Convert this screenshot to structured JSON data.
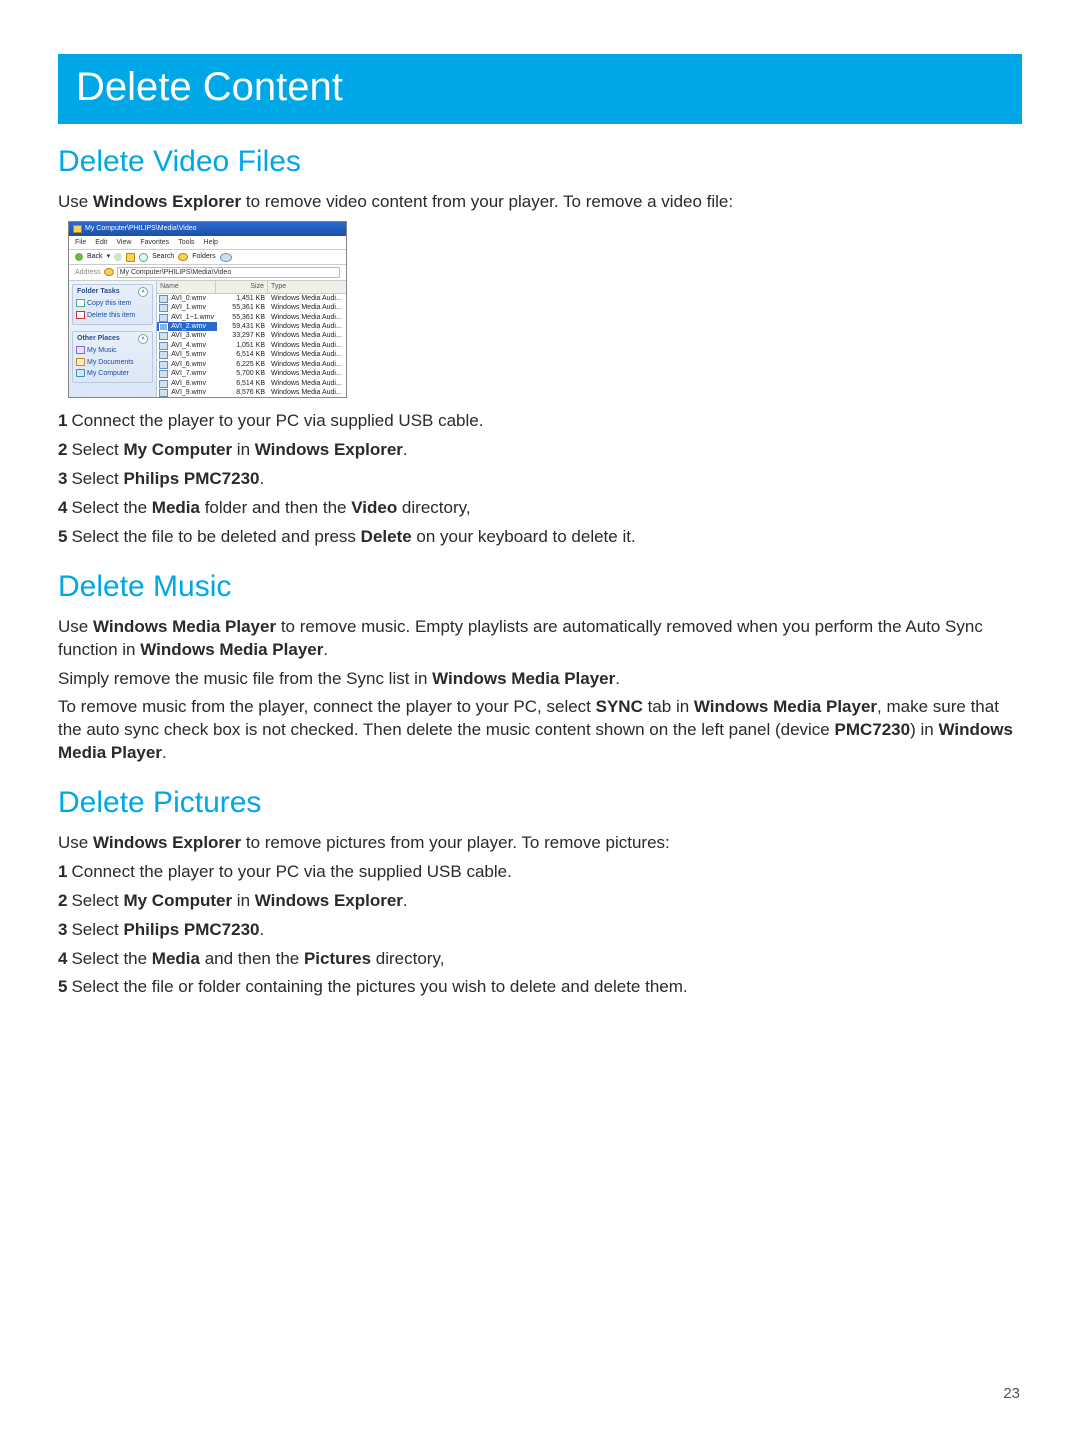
{
  "page_number": "23",
  "banner": "Delete Content",
  "sections": {
    "video": {
      "heading": "Delete Video Files",
      "intro_a": "Use ",
      "intro_b": "Windows Explorer",
      "intro_c": " to remove video content from your player. To remove a video file:",
      "steps": {
        "s1": "Connect the player to your PC via supplied USB cable.",
        "s2a": "Select ",
        "s2b": "My Computer",
        "s2c": " in ",
        "s2d": "Windows Explorer",
        "s2e": ".",
        "s3a": "Select ",
        "s3b": "Philips PMC7230",
        "s3c": ".",
        "s4a": "Select the ",
        "s4b": "Media",
        "s4c": " folder and then the ",
        "s4d": "Video",
        "s4e": " directory,",
        "s5a": "Select the file to be deleted and press ",
        "s5b": "Delete",
        "s5c": " on your keyboard to delete it."
      }
    },
    "music": {
      "heading": "Delete Music",
      "p1a": "Use ",
      "p1b": "Windows Media Player",
      "p1c": " to remove music. Empty playlists are automatically removed when you perform the Auto Sync function in ",
      "p1d": "Windows Media Player",
      "p1e": ".",
      "p2a": "Simply remove the music file from the Sync list in ",
      "p2b": "Windows Media Player",
      "p2c": ".",
      "p3a": "To remove music from the player, connect the player to your PC, select ",
      "p3b": "SYNC",
      "p3c": " tab in ",
      "p3d": "Windows Media Player",
      "p3e": ", make sure that the auto sync check box is not checked. Then delete the music content shown on the left panel (device ",
      "p3f": "PMC7230",
      "p3g": ") in ",
      "p3h": "Windows Media Player",
      "p3i": "."
    },
    "pictures": {
      "heading": "Delete Pictures",
      "intro_a": "Use ",
      "intro_b": "Windows Explorer",
      "intro_c": " to remove pictures from your player. To remove pictures:",
      "steps": {
        "s1": "Connect the player to your PC via the supplied USB cable.",
        "s2a": "Select ",
        "s2b": "My Computer",
        "s2c": " in ",
        "s2d": "Windows Explorer",
        "s2e": ".",
        "s3a": "Select ",
        "s3b": "Philips PMC7230",
        "s3c": ".",
        "s4a": "Select the ",
        "s4b": "Media",
        "s4c": " and then the ",
        "s4d": "Pictures",
        "s4e": " directory,",
        "s5": "Select the file or folder containing the pictures you wish to delete and delete them."
      }
    }
  },
  "explorer": {
    "title": "My Computer\\PHILIPS\\Media\\Video",
    "menu": [
      "File",
      "Edit",
      "View",
      "Favorites",
      "Tools",
      "Help"
    ],
    "back": "Back",
    "search": "Search",
    "folders": "Folders",
    "address_label": "Address",
    "address_path": "My Computer\\PHILIPS\\Media\\Video",
    "side": {
      "tasks_h": "Folder Tasks",
      "task_copy": "Copy this item",
      "task_delete": "Delete this item",
      "places_h": "Other Places",
      "place_music": "My Music",
      "place_docs": "My Documents",
      "place_comp": "My Computer"
    },
    "cols": {
      "name": "Name",
      "size": "Size",
      "type": "Type"
    },
    "type_label": "Windows Media Audi...",
    "rows": [
      {
        "name": "AVI_0.wmv",
        "size": "1,451 KB",
        "sel": false
      },
      {
        "name": "AVI_1.wmv",
        "size": "55,361 KB",
        "sel": false
      },
      {
        "name": "AVI_1~1.wmv",
        "size": "55,361 KB",
        "sel": false
      },
      {
        "name": "AVI_2.wmv",
        "size": "59,431 KB",
        "sel": true
      },
      {
        "name": "AVI_3.wmv",
        "size": "33,297 KB",
        "sel": false
      },
      {
        "name": "AVI_4.wmv",
        "size": "1,051 KB",
        "sel": false
      },
      {
        "name": "AVI_5.wmv",
        "size": "6,514 KB",
        "sel": false
      },
      {
        "name": "AVI_6.wmv",
        "size": "6,225 KB",
        "sel": false
      },
      {
        "name": "AVI_7.wmv",
        "size": "5,700 KB",
        "sel": false
      },
      {
        "name": "AVI_8.wmv",
        "size": "6,514 KB",
        "sel": false
      },
      {
        "name": "AVI_9.wmv",
        "size": "8,576 KB",
        "sel": false
      }
    ]
  }
}
